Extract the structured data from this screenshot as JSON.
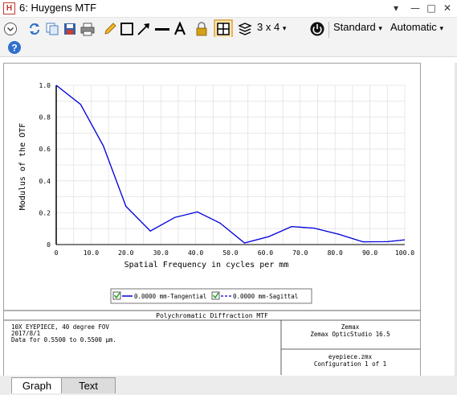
{
  "window": {
    "app_icon_letter": "H",
    "title": "6: Huygens MTF",
    "controls": [
      "▾",
      "—",
      "□",
      "✕"
    ]
  },
  "toolbar": {
    "grid_label": "3 x 4",
    "standard_label": "Standard",
    "automatic_label": "Automatic",
    "dropdown_glyph": "▾",
    "icons": [
      "collapse-icon",
      "refresh-icon",
      "copy-icon",
      "save-icon",
      "print-icon",
      "pencil-icon",
      "rectangle-icon",
      "arrow-icon",
      "line-icon",
      "text-icon",
      "lock-icon",
      "window-grid-icon",
      "layers-icon",
      "grid-size-icon",
      "dark-theme-icon",
      "help-icon"
    ]
  },
  "legend": {
    "items": [
      {
        "text": "0.0000 mm-Tangential",
        "color": "#0000dd"
      },
      {
        "text": "0.0000 mm-Sagittal",
        "color": "#0000dd"
      }
    ]
  },
  "info": {
    "title": "Polychromatic Diffraction MTF",
    "left_lines": [
      "10X EYEPIECE, 40 degree FOV",
      "2017/8/1",
      "Data for 0.5500 to 0.5500 µm."
    ],
    "right_top_lines": [
      "Zemax",
      "Zemax OpticStudio 16.5"
    ],
    "right_bottom_lines": [
      "eyepiece.zmx",
      "Configuration 1 of 1"
    ]
  },
  "tabs": [
    {
      "label": "Graph",
      "active": true
    },
    {
      "label": "Text",
      "active": false
    }
  ],
  "chart_data": {
    "type": "line",
    "title": "",
    "xlabel": "Spatial Frequency in cycles per mm",
    "ylabel": "Modulus of the OTF",
    "xlim": [
      0,
      100
    ],
    "ylim": [
      0,
      1
    ],
    "x_ticks": [
      "0",
      "10.0",
      "20.0",
      "30.0",
      "40.0",
      "50.0",
      "60.0",
      "70.0",
      "80.0",
      "90.0",
      "100.0"
    ],
    "y_ticks": [
      "0",
      "0.2",
      "0.4",
      "0.6",
      "0.8",
      "1.0"
    ],
    "grid": true,
    "legend_position": "bottom",
    "series": [
      {
        "name": "0.0000 mm-Tangential",
        "color": "#0000dd",
        "x": [
          0,
          7,
          13.5,
          20,
          27,
          34,
          40.5,
          47,
          54,
          61,
          67.5,
          74,
          81,
          88,
          95,
          100
        ],
        "y": [
          1.0,
          0.88,
          0.62,
          0.24,
          0.085,
          0.17,
          0.205,
          0.135,
          0.01,
          0.05,
          0.113,
          0.103,
          0.065,
          0.017,
          0.018,
          0.03
        ]
      },
      {
        "name": "0.0000 mm-Sagittal",
        "color": "#0000dd",
        "x": [
          0,
          7,
          13.5,
          20,
          27,
          34,
          40.5,
          47,
          54,
          61,
          67.5,
          74,
          81,
          88,
          95,
          100
        ],
        "y": [
          1.0,
          0.88,
          0.62,
          0.24,
          0.085,
          0.17,
          0.205,
          0.135,
          0.01,
          0.05,
          0.113,
          0.103,
          0.065,
          0.017,
          0.018,
          0.03
        ]
      }
    ]
  }
}
